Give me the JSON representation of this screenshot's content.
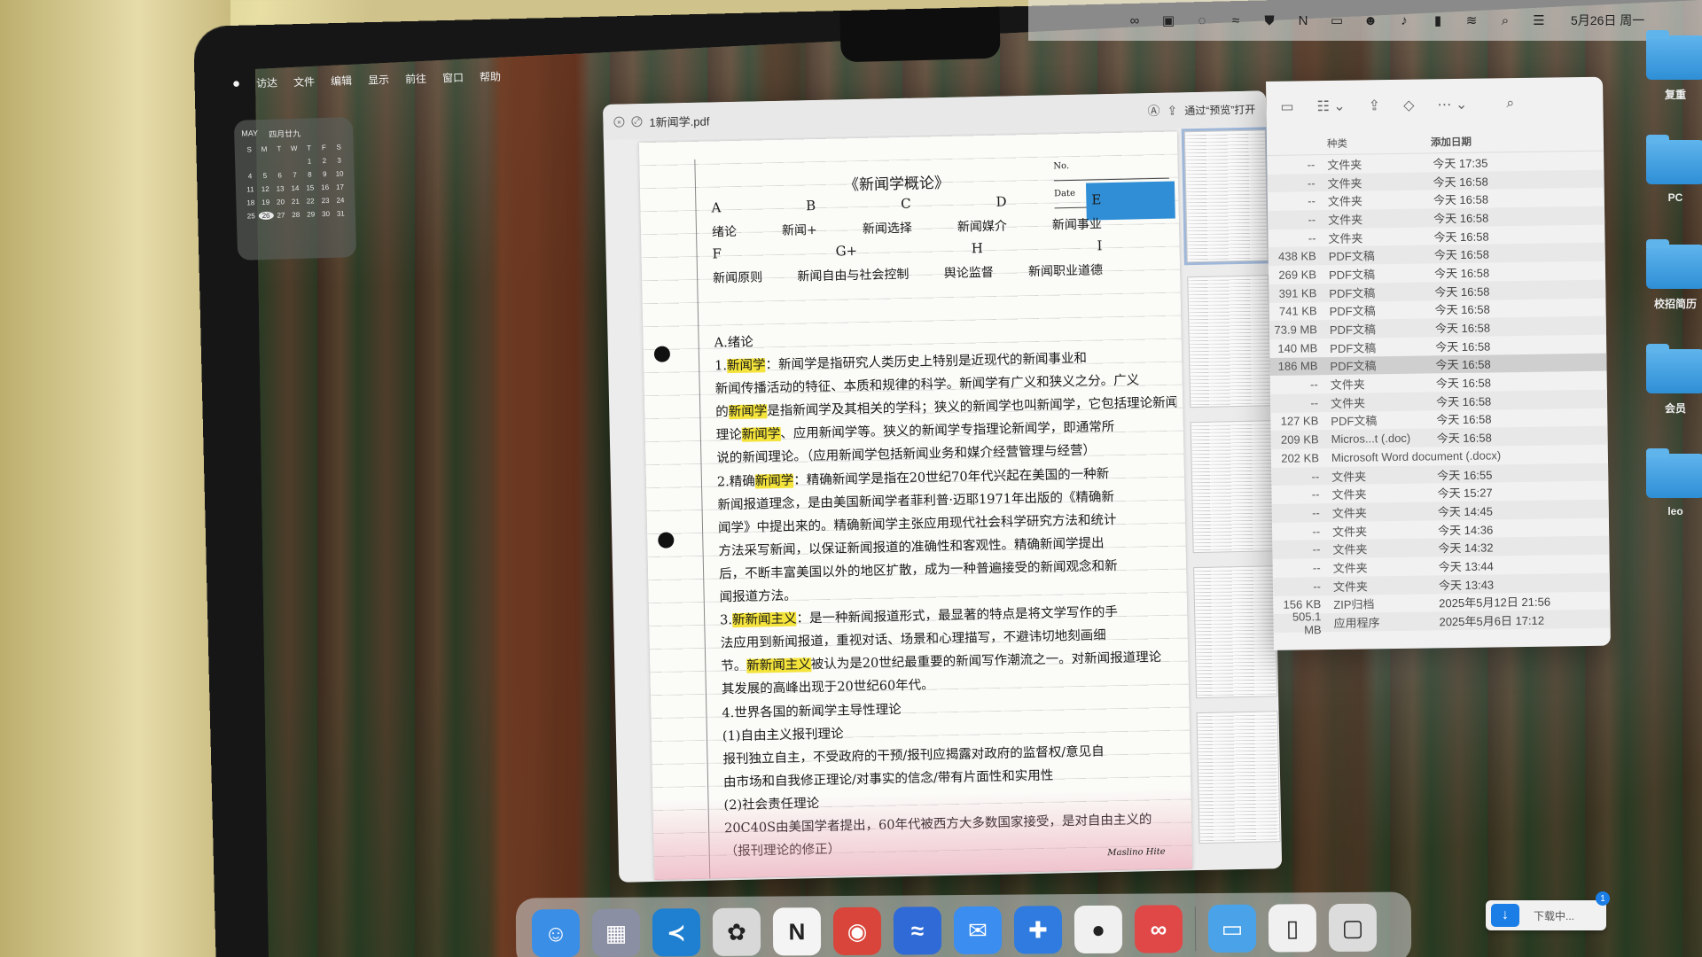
{
  "menu_bar": {
    "apple": "",
    "items": [
      "访达",
      "文件",
      "编辑",
      "显示",
      "前往",
      "窗口",
      "帮助"
    ]
  },
  "status_bar": {
    "icons": [
      "creative-cloud-icon",
      "screenshot-icon",
      "chat-icon",
      "lark-icon",
      "vpn-shield-icon",
      "notion-icon",
      "display-icon",
      "user-icon",
      "music-icon",
      "battery-icon",
      "wifi-icon",
      "search-icon",
      "control-center-icon"
    ],
    "date": "5月26日 周一"
  },
  "calendar": {
    "month": "MAY",
    "lunar": "四月廿九",
    "weekdays": [
      "S",
      "M",
      "T",
      "W",
      "T",
      "F",
      "S"
    ],
    "days": [
      "",
      "",
      "",
      "",
      "1",
      "2",
      "3",
      "4",
      "5",
      "6",
      "7",
      "8",
      "9",
      "10",
      "11",
      "12",
      "13",
      "14",
      "15",
      "16",
      "17",
      "18",
      "19",
      "20",
      "21",
      "22",
      "23",
      "24",
      "25",
      "26",
      "27",
      "28",
      "29",
      "30",
      "31"
    ],
    "today": "26"
  },
  "pdf_window": {
    "title": "1新闻学.pdf",
    "open_with_label": "通过“预览”打开",
    "page": {
      "meta_no": "No.",
      "meta_date": "Date",
      "title": "《新闻学概论》",
      "toc_letters_1": [
        "A",
        "B",
        "C",
        "D",
        "E"
      ],
      "toc_items_1": [
        "绪论",
        "新闻+",
        "新闻选择",
        "新闻媒介",
        "新闻事业"
      ],
      "toc_letters_2": [
        "F",
        "G+",
        "H",
        "I"
      ],
      "toc_items_2": [
        "新闻原则",
        "新闻自由与社会控制",
        "舆论监督",
        "新闻职业道德"
      ],
      "notes": [
        "A.绪论",
        "1.新闻学：新闻学是指研究人类历史上特别是近现代的新闻事业和",
        "新闻传播活动的特征、本质和规律的科学。新闻学有广义和狭义之分。广义",
        "的新闻学是指新闻学及其相关的学科；狭义的新闻学也叫新闻学，它包括理论新闻学、",
        "理论新闻学、应用新闻学等。狭义的新闻学专指理论新闻学，即通常所",
        "说的新闻理论。（应用新闻学包括新闻业务和媒介经营管理与经营）",
        "2.精确新闻学：精确新闻学是指在20世纪70年代兴起在美国的一种新",
        "新闻报道理念，是由美国新闻学者菲利普·迈耶1971年出版的《精确新",
        "闻学》中提出来的。精确新闻学主张应用现代社会科学研究方法和统计",
        "方法采写新闻，以保证新闻报道的准确性和客观性。精确新闻学提出",
        "后，不断丰富美国以外的地区扩散，成为一种普遍接受的新闻观念和新",
        "闻报道方法。",
        "3.新新闻主义：是一种新闻报道形式，最显著的特点是将文学写作的手",
        "法应用到新闻报道，重视对话、场景和心理描写，不避讳切地刻画细",
        "节。新新闻主义被认为是20世纪最重要的新闻写作潮流之一。对新闻报道理论",
        "其发展的高峰出现于20世纪60年代。",
        "4.世界各国的新闻学主导性理论",
        "(1)自由主义报刊理论",
        "  报刊独立自主，不受政府的干预/报刊应揭露对政府的监督权/意见自",
        "由市场和自我修正理论/对事实的信念/带有片面性和实用性",
        "(2)社会责任理论",
        "  20C40S由美国学者提出，60年代被西方大多数国家接受，是对自由主义的",
        "  （报刊理论的修正）"
      ],
      "watermark": "Maslino Hite"
    }
  },
  "finder": {
    "columns": [
      "种类",
      "添加日期"
    ],
    "rows": [
      {
        "size": "--",
        "kind": "文件夹",
        "date": "今天 17:35"
      },
      {
        "size": "--",
        "kind": "文件夹",
        "date": "今天 16:58"
      },
      {
        "size": "--",
        "kind": "文件夹",
        "date": "今天 16:58"
      },
      {
        "size": "--",
        "kind": "文件夹",
        "date": "今天 16:58"
      },
      {
        "size": "--",
        "kind": "文件夹",
        "date": "今天 16:58"
      },
      {
        "size": "438 KB",
        "kind": "PDF文稿",
        "date": "今天 16:58"
      },
      {
        "size": "269 KB",
        "kind": "PDF文稿",
        "date": "今天 16:58"
      },
      {
        "size": "391 KB",
        "kind": "PDF文稿",
        "date": "今天 16:58"
      },
      {
        "size": "741 KB",
        "kind": "PDF文稿",
        "date": "今天 16:58"
      },
      {
        "size": "73.9 MB",
        "kind": "PDF文稿",
        "date": "今天 16:58"
      },
      {
        "size": "140 MB",
        "kind": "PDF文稿",
        "date": "今天 16:58"
      },
      {
        "size": "186 MB",
        "kind": "PDF文稿",
        "date": "今天 16:58"
      },
      {
        "size": "--",
        "kind": "文件夹",
        "date": "今天 16:58"
      },
      {
        "size": "--",
        "kind": "文件夹",
        "date": "今天 16:58"
      },
      {
        "size": "127 KB",
        "kind": "PDF文稿",
        "date": "今天 16:58"
      },
      {
        "size": "209 KB",
        "kind": "Micros...t (.doc)",
        "date": "今天 16:58"
      },
      {
        "size": "202 KB",
        "kind": "Microsoft Word document (.docx)",
        "date": ""
      },
      {
        "size": "--",
        "kind": "文件夹",
        "date": "今天 16:55"
      },
      {
        "size": "--",
        "kind": "文件夹",
        "date": "今天 15:27"
      },
      {
        "size": "--",
        "kind": "文件夹",
        "date": "今天 14:45"
      },
      {
        "size": "--",
        "kind": "文件夹",
        "date": "今天 14:36"
      },
      {
        "size": "--",
        "kind": "文件夹",
        "date": "今天 14:32"
      },
      {
        "size": "--",
        "kind": "文件夹",
        "date": "今天 13:44"
      },
      {
        "size": "--",
        "kind": "文件夹",
        "date": "今天 13:43"
      },
      {
        "size": "156 KB",
        "kind": "ZIP归档",
        "date": "2025年5月12日 21:56"
      },
      {
        "size": "505.1 MB",
        "kind": "应用程序",
        "date": "2025年5月6日 17:12"
      }
    ],
    "selected_row": 11
  },
  "desktop_icons": [
    {
      "label": "复重"
    },
    {
      "label": "PC"
    },
    {
      "label": "校招简历"
    },
    {
      "label": "会员"
    },
    {
      "label": "leo"
    }
  ],
  "dock": {
    "apps": [
      {
        "name": "finder-icon",
        "glyph": "☺",
        "color": "#3a8ee6"
      },
      {
        "name": "launchpad-icon",
        "glyph": "▦",
        "color": "#8a8fa3"
      },
      {
        "name": "vscode-icon",
        "glyph": "≺",
        "color": "#1f7fd0"
      },
      {
        "name": "chatgpt-icon",
        "glyph": "✿",
        "color": "#d8d8d8"
      },
      {
        "name": "notion-icon",
        "glyph": "N",
        "color": "#f4f4f4"
      },
      {
        "name": "chrome-icon",
        "glyph": "◉",
        "color": "#d9453a"
      },
      {
        "name": "lark-icon",
        "glyph": "≈",
        "color": "#2f6ad6"
      },
      {
        "name": "messages-icon",
        "glyph": "✉",
        "color": "#3b8df0"
      },
      {
        "name": "tencent-meeting-icon",
        "glyph": "✚",
        "color": "#2f7be0"
      },
      {
        "name": "panda-app-icon",
        "glyph": "●",
        "color": "#f0f0f0"
      },
      {
        "name": "creative-cloud-icon",
        "glyph": "∞",
        "color": "#e04848"
      },
      {
        "name": "downloads-folder-icon",
        "glyph": "▭",
        "color": "#4aa3e8"
      },
      {
        "name": "document-stack-icon",
        "glyph": "▯",
        "color": "#f0f0f0"
      },
      {
        "name": "trash-icon",
        "glyph": "▢",
        "color": "#dcdcdc"
      }
    ]
  },
  "download": {
    "label": "下载中...",
    "badge": "1"
  }
}
